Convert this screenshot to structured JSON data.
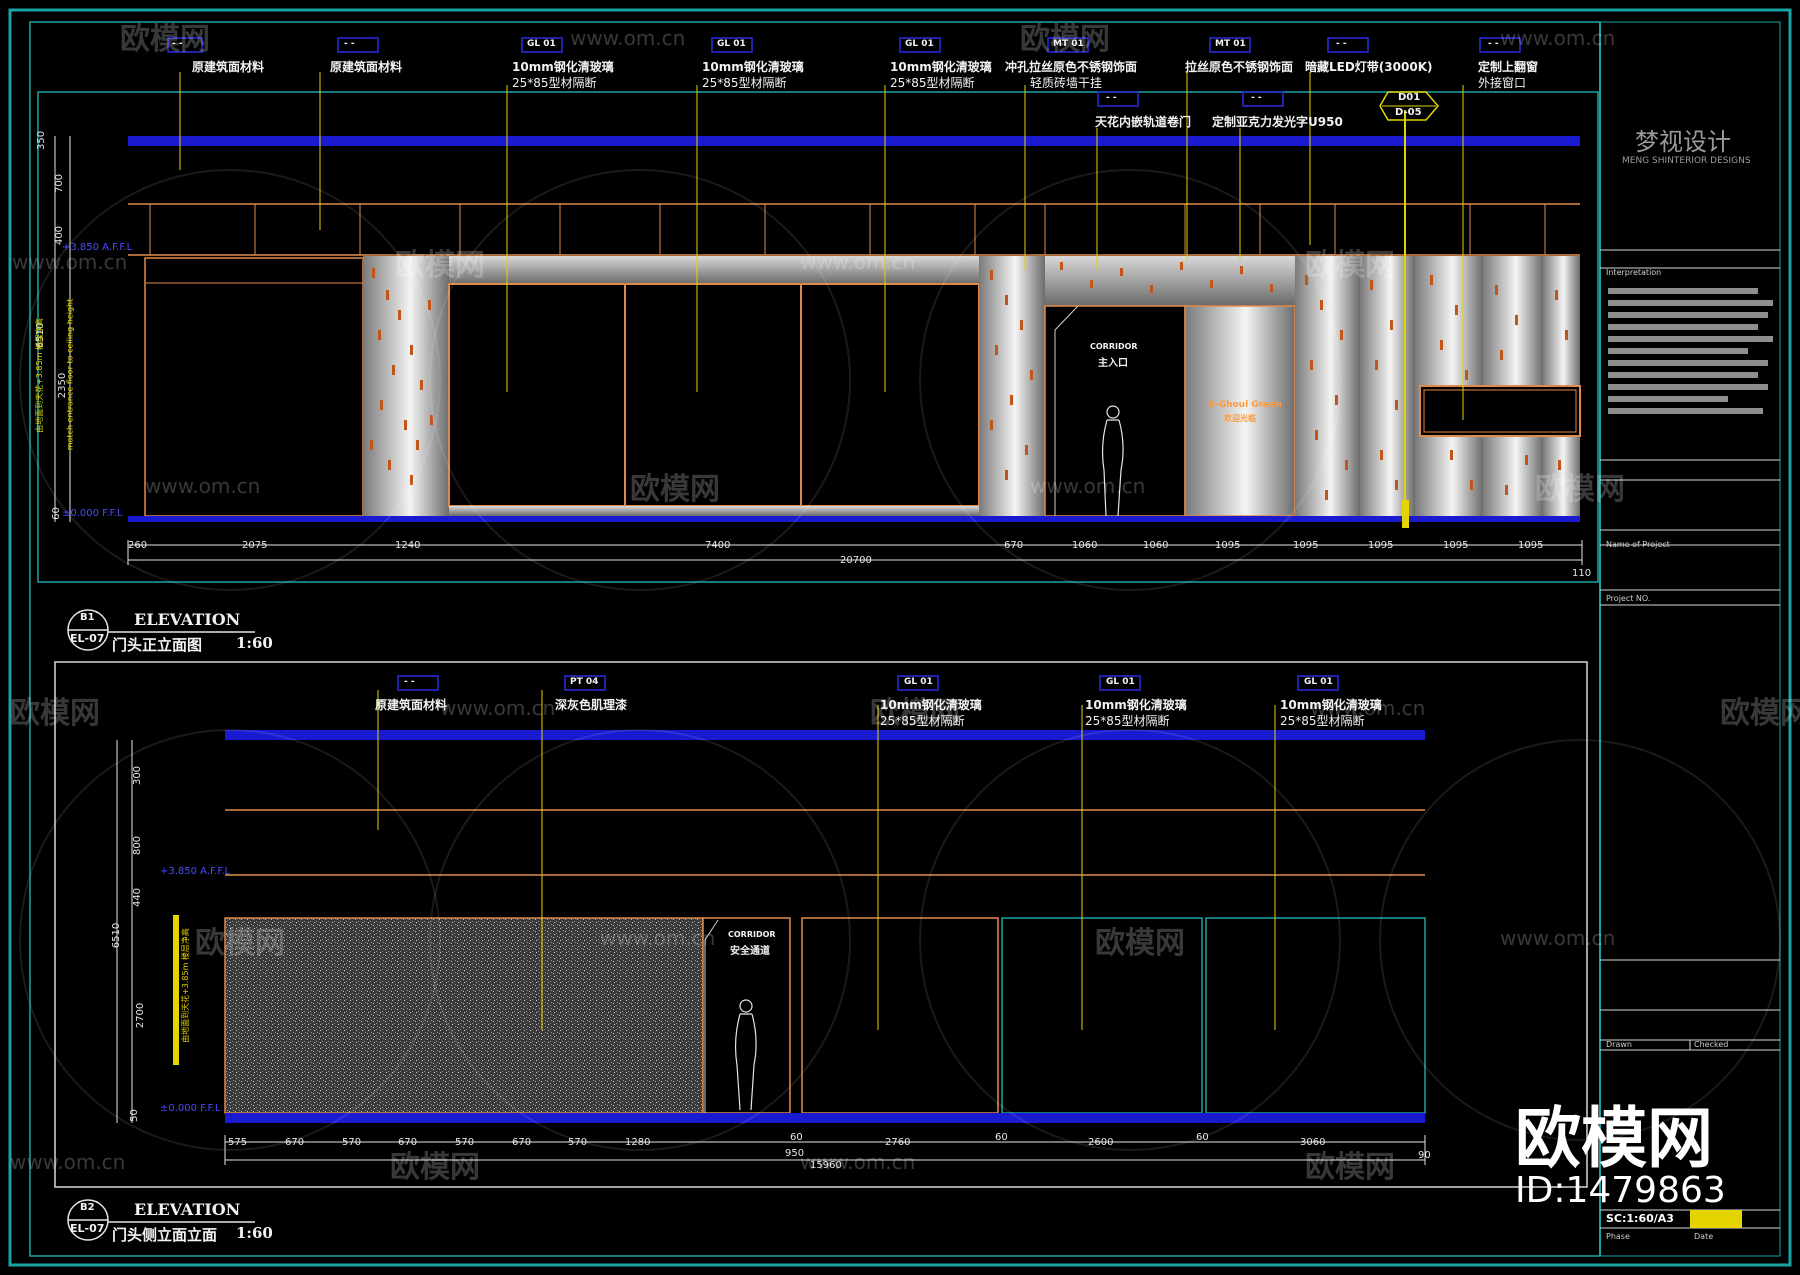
{
  "brand": {
    "name_cn": "梦视设计",
    "name_en": "MENG SHINTERIOR DESIGNS"
  },
  "watermark": {
    "logo_text": "欧模网",
    "url": "www.om.cn",
    "id_text": "ID:1479863"
  },
  "elevation1": {
    "word": "ELEVATION",
    "tag_top": "B1",
    "tag_bottom": "EL-07",
    "title": "门头正立面图",
    "scale": "1:60",
    "labels": [
      {
        "code": "-  -",
        "text": "原建筑面材料"
      },
      {
        "code": "-  -",
        "text": "原建筑面材料"
      },
      {
        "code": "GL  01",
        "text": "10mm钢化清玻璃",
        "text2": "25*85型材隔断"
      },
      {
        "code": "GL  01",
        "text": "10mm钢化清玻璃",
        "text2": "25*85型材隔断"
      },
      {
        "code": "GL  01",
        "text": "10mm钢化清玻璃",
        "text2": "25*85型材隔断"
      },
      {
        "code": "MT  01",
        "text": "冲孔拉丝原色不锈钢饰面",
        "text2": "轻质砖墙干挂"
      },
      {
        "code": "MT  01",
        "text": "拉丝原色不锈钢饰面"
      },
      {
        "code": "-  -",
        "text": "暗藏LED灯带(3000K)"
      },
      {
        "code": "-  -",
        "text": "定制上翻窗",
        "text2": "外接窗口"
      },
      {
        "code": "-  -",
        "text": "天花内嵌轨道卷门"
      },
      {
        "code": "-  -",
        "text": "定制亚克力发光字U950"
      }
    ],
    "section_tag": {
      "top": "D01",
      "bottom": "D-05"
    },
    "heights": [
      "350",
      "700",
      "400",
      "2350",
      "60"
    ],
    "total_height": "6510",
    "level_marks": [
      "+3.850 A.F.F.L",
      "±0.000 F.F.L"
    ],
    "vertical_note": "由地面到天花+3.85m 楼层净高",
    "vertical_note2": "match entrance floor to ceiling height",
    "entrance_sign": "主入口",
    "entrance_sign_en": "CORRIDOR",
    "logo_sign": "A-Ghoul Green",
    "logo_sign2": "欢迎光临",
    "dims": [
      "260",
      "2075",
      "1240",
      "7400",
      "670",
      "1060",
      "1060",
      "1095",
      "1095",
      "1095",
      "1095",
      "1095"
    ],
    "total": "20700",
    "end_dim": "110"
  },
  "elevation2": {
    "word": "ELEVATION",
    "tag_top": "B2",
    "tag_bottom": "EL-07",
    "title": "门头侧立面立面",
    "scale": "1:60",
    "labels": [
      {
        "code": "-  -",
        "text": "原建筑面材料"
      },
      {
        "code": "PT  04",
        "text": "深灰色肌理漆"
      },
      {
        "code": "GL  01",
        "text": "10mm钢化清玻璃",
        "text2": "25*85型材隔断"
      },
      {
        "code": "GL  01",
        "text": "10mm钢化清玻璃",
        "text2": "25*85型材隔断"
      },
      {
        "code": "GL  01",
        "text": "10mm钢化清玻璃",
        "text2": "25*85型材隔断"
      }
    ],
    "heights": [
      "300",
      "800",
      "440",
      "2700",
      "50"
    ],
    "total_height": "6510",
    "level_marks": [
      "+3.850 A.F.F.L",
      "±0.000 F.F.L"
    ],
    "vertical_note": "由地面到天花+3.85m 楼层净高",
    "door_sign": "安全通道",
    "door_sign_en": "CORRIDOR",
    "dims": [
      "575",
      "670",
      "570",
      "670",
      "570",
      "670",
      "570",
      "1280",
      "60",
      "2760",
      "60",
      "2600",
      "60",
      "3060"
    ],
    "total": "15960",
    "sub_dim": "950",
    "end_dim": "90"
  },
  "titleblock": {
    "interpretation": "Interpretation",
    "name_of_project": "Name of Project",
    "project_no": "Project NO.",
    "drawn": "Drawn",
    "checked": "Checked",
    "scale_label": "SC:1:60/A3",
    "phase": "Phase",
    "date": "Date"
  }
}
